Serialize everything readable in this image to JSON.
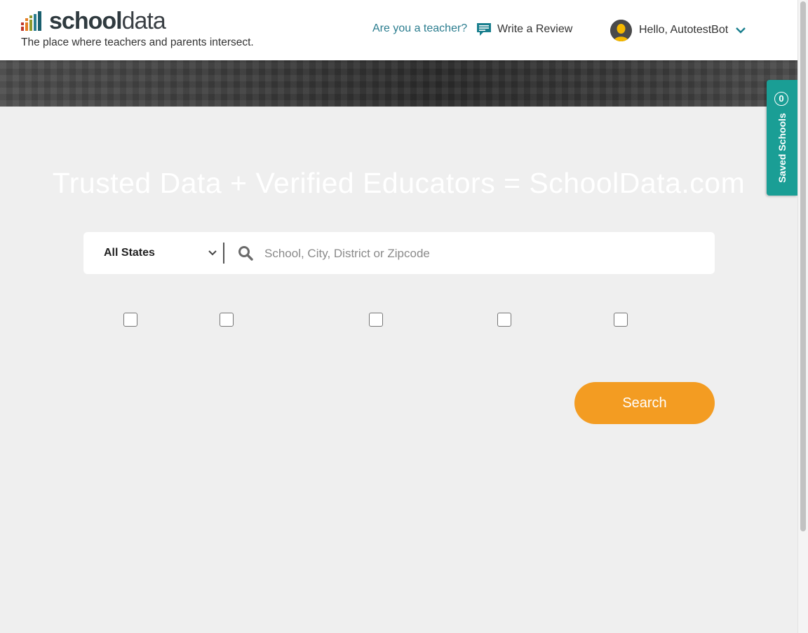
{
  "header": {
    "logo_bold": "school",
    "logo_thin": "data",
    "tagline": "The place where teachers and parents intersect.",
    "teacher_link": "Are you a teacher?",
    "review_link": "Write a Review",
    "user_greeting": "Hello, AutotestBot"
  },
  "hero": {
    "title": "Trusted Data + Verified Educators = SchoolData.com"
  },
  "search": {
    "state_selected": "All States",
    "placeholder": "School, City, District or Zipcode",
    "button_label": "Search"
  },
  "filters": [
    {
      "checked": false
    },
    {
      "checked": false
    },
    {
      "checked": false
    },
    {
      "checked": false
    },
    {
      "checked": false
    }
  ],
  "saved_schools": {
    "count": "0",
    "label": "Saved Schools"
  },
  "colors": {
    "accent_teal": "#1a9e95",
    "link_teal": "#2b7d8f",
    "search_orange": "#f39c22",
    "background": "#efefef"
  },
  "icons": {
    "review": "speech-bubble-icon",
    "search": "magnifier-icon",
    "dropdown": "chevron-down-icon",
    "avatar": "user-silhouette-icon"
  }
}
